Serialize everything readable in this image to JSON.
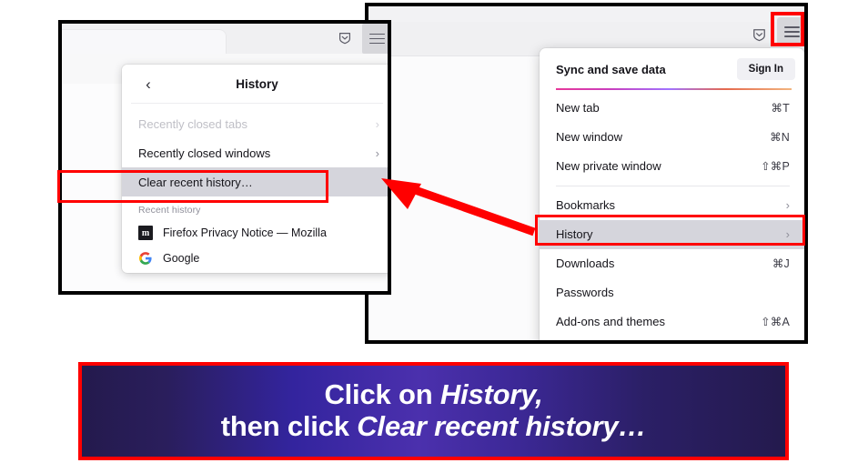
{
  "left_window": {
    "name": "firefox-history-submenu-screenshot",
    "toolbar": {
      "shield_icon": "shield-icon",
      "menu_icon": "hamburger-menu-icon"
    },
    "popup": {
      "back_icon": "chevron-left-icon",
      "title": "History",
      "items": [
        {
          "label": "Recently closed tabs",
          "chevron": "›",
          "dimmed": true,
          "highlighted": false
        },
        {
          "label": "Recently closed windows",
          "chevron": "›",
          "dimmed": false,
          "highlighted": false
        },
        {
          "label": "Clear recent history…",
          "chevron": "",
          "dimmed": false,
          "highlighted": true
        }
      ],
      "section_label": "Recent history",
      "history_entries": [
        {
          "favicon": "mozilla-favicon",
          "glyph": "m",
          "title": "Firefox Privacy Notice — Mozilla"
        },
        {
          "favicon": "google-favicon",
          "glyph": "G",
          "title": "Google"
        }
      ]
    }
  },
  "right_window": {
    "name": "firefox-main-menu-screenshot",
    "toolbar": {
      "shield_icon": "shield-icon",
      "menu_icon": "hamburger-menu-icon"
    },
    "menu": {
      "sync_label": "Sync and save data",
      "signin_label": "Sign In",
      "items": [
        {
          "label": "New tab",
          "accel": "⌘T",
          "chevron": "",
          "highlighted": false,
          "sep_after": false
        },
        {
          "label": "New window",
          "accel": "⌘N",
          "chevron": "",
          "highlighted": false,
          "sep_after": false
        },
        {
          "label": "New private window",
          "accel": "⇧⌘P",
          "chevron": "",
          "highlighted": false,
          "sep_after": true
        },
        {
          "label": "Bookmarks",
          "accel": "",
          "chevron": "›",
          "highlighted": false,
          "sep_after": false
        },
        {
          "label": "History",
          "accel": "",
          "chevron": "›",
          "highlighted": true,
          "sep_after": false
        },
        {
          "label": "Downloads",
          "accel": "⌘J",
          "chevron": "",
          "highlighted": false,
          "sep_after": false
        },
        {
          "label": "Passwords",
          "accel": "",
          "chevron": "",
          "highlighted": false,
          "sep_after": false
        },
        {
          "label": "Add-ons and themes",
          "accel": "⇧⌘A",
          "chevron": "",
          "highlighted": false,
          "sep_after": true
        }
      ]
    }
  },
  "annotations": {
    "arrow": "red-arrow-pointing-left",
    "highlight_boxes": [
      "clear-recent-history-box",
      "history-menu-item-box",
      "hamburger-menu-button-box"
    ],
    "colors": {
      "highlight_red": "#ff0000",
      "banner_dark": "#241a4d",
      "banner_bright": "#4b30ad",
      "menu_highlight_gray": "#d5d5dc"
    }
  },
  "caption": {
    "line1_prefix": "Click on ",
    "line1_em": "History,",
    "line2_prefix": "then click ",
    "line2_em": "Clear recent history…"
  }
}
